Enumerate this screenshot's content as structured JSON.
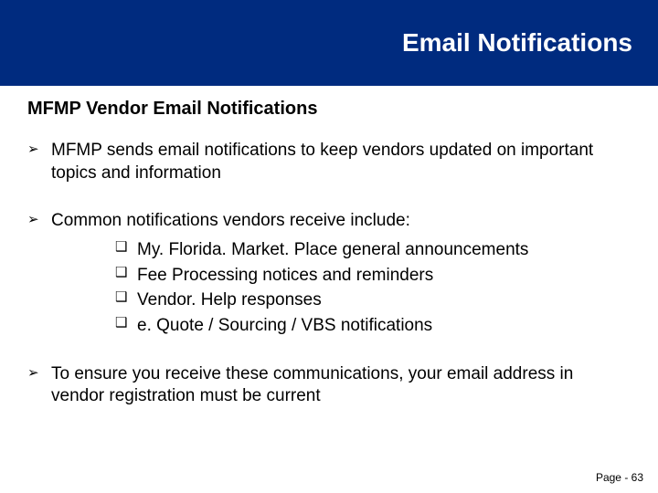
{
  "header": {
    "title": "Email Notifications"
  },
  "subhead": "MFMP Vendor Email Notifications",
  "bullets": [
    {
      "text": "MFMP sends email notifications to keep vendors updated on important topics and information"
    },
    {
      "text": "Common notifications vendors receive include:",
      "sub": [
        "My. Florida. Market. Place general announcements",
        "Fee Processing notices and reminders",
        "Vendor. Help responses",
        "e. Quote / Sourcing / VBS notifications"
      ]
    },
    {
      "text": "To ensure you receive these communications, your email address in vendor registration must be current"
    }
  ],
  "footer": {
    "page_label": "Page - 63"
  }
}
